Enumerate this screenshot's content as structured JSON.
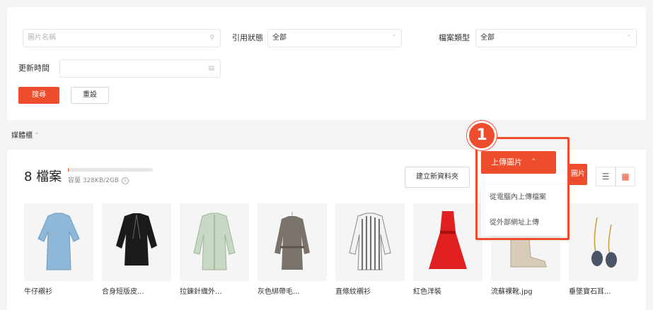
{
  "filters": {
    "image_name_placeholder": "圖片名稱",
    "ref_status_label": "引用狀態",
    "ref_status_value": "全部",
    "file_type_label": "檔案類型",
    "file_type_value": "全部",
    "updated_label": "更新時間",
    "search_label": "搜尋",
    "reset_label": "重設"
  },
  "media_toggle": "媒體櫃",
  "files": {
    "title": "8 檔案",
    "capacity_text": "容量 328KB/2GB",
    "capacity_fraction": 0.0002,
    "new_folder_label": "建立新資料夾",
    "hidden_btn_text": "圖片",
    "items": [
      {
        "name": "牛仔襯衫"
      },
      {
        "name": "合身短版皮..."
      },
      {
        "name": "拉鍊針織外..."
      },
      {
        "name": "灰色綁帶毛..."
      },
      {
        "name": "直條紋襯衫"
      },
      {
        "name": "紅色洋裝"
      },
      {
        "name": "流蘇裸靴.jpg"
      },
      {
        "name": "垂墜寶石耳..."
      }
    ]
  },
  "upload": {
    "button_label": "上傳圖片",
    "menu": [
      "從電腦內上傳檔案",
      "從外部網址上傳"
    ]
  },
  "callout_number": "1",
  "colors": {
    "accent": "#ee4d2d"
  }
}
